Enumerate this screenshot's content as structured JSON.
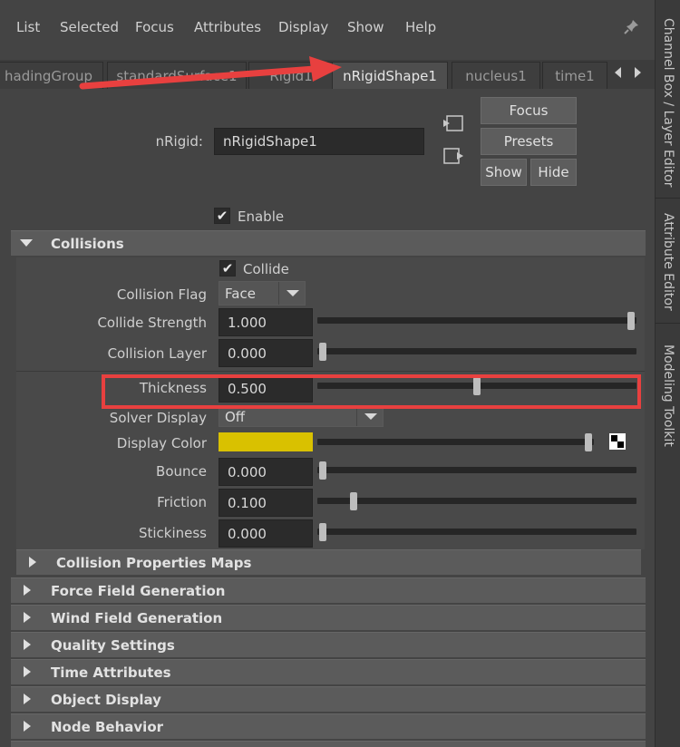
{
  "menu": {
    "items": [
      "List",
      "Selected",
      "Focus",
      "Attributes",
      "Display",
      "Show",
      "Help"
    ],
    "pin_icon": "pin-icon"
  },
  "side_tabs": [
    "Channel Box / Layer Editor",
    "Attribute Editor",
    "Modeling Toolkit"
  ],
  "node_tabs": [
    "hadingGroup",
    "standardSurface1",
    "Rigid1",
    "nRigidShape1",
    "nucleus1",
    "time1"
  ],
  "active_tab": "nRigidShape1",
  "header": {
    "node_label": "nRigid:",
    "node_name": "nRigidShape1",
    "buttons": {
      "focus": "Focus",
      "presets": "Presets",
      "show": "Show",
      "hide": "Hide"
    },
    "enable_label": "Enable",
    "enable_checked": true
  },
  "collisions": {
    "title": "Collisions",
    "collide_label": "Collide",
    "collide_checked": true,
    "collision_flag": {
      "label": "Collision Flag",
      "value": "Face"
    },
    "collide_strength": {
      "label": "Collide Strength",
      "value": "1.000",
      "fraction": 1.0
    },
    "collision_layer": {
      "label": "Collision Layer",
      "value": "0.000",
      "fraction": 0.0
    },
    "thickness": {
      "label": "Thickness",
      "value": "0.500",
      "fraction": 0.5
    },
    "solver_display": {
      "label": "Solver Display",
      "value": "Off"
    },
    "display_color": {
      "label": "Display Color",
      "color": "#d9c100",
      "fraction": 1.0
    },
    "bounce": {
      "label": "Bounce",
      "value": "0.000",
      "fraction": 0.0
    },
    "friction": {
      "label": "Friction",
      "value": "0.100",
      "fraction": 0.1
    },
    "stickiness": {
      "label": "Stickiness",
      "value": "0.000",
      "fraction": 0.0
    },
    "subsection": "Collision Properties Maps"
  },
  "sections": [
    "Force Field Generation",
    "Wind Field Generation",
    "Quality Settings",
    "Time Attributes",
    "Object Display",
    "Node Behavior"
  ],
  "colors": {
    "annotation_red": "#e8403f",
    "background": "#444444"
  }
}
